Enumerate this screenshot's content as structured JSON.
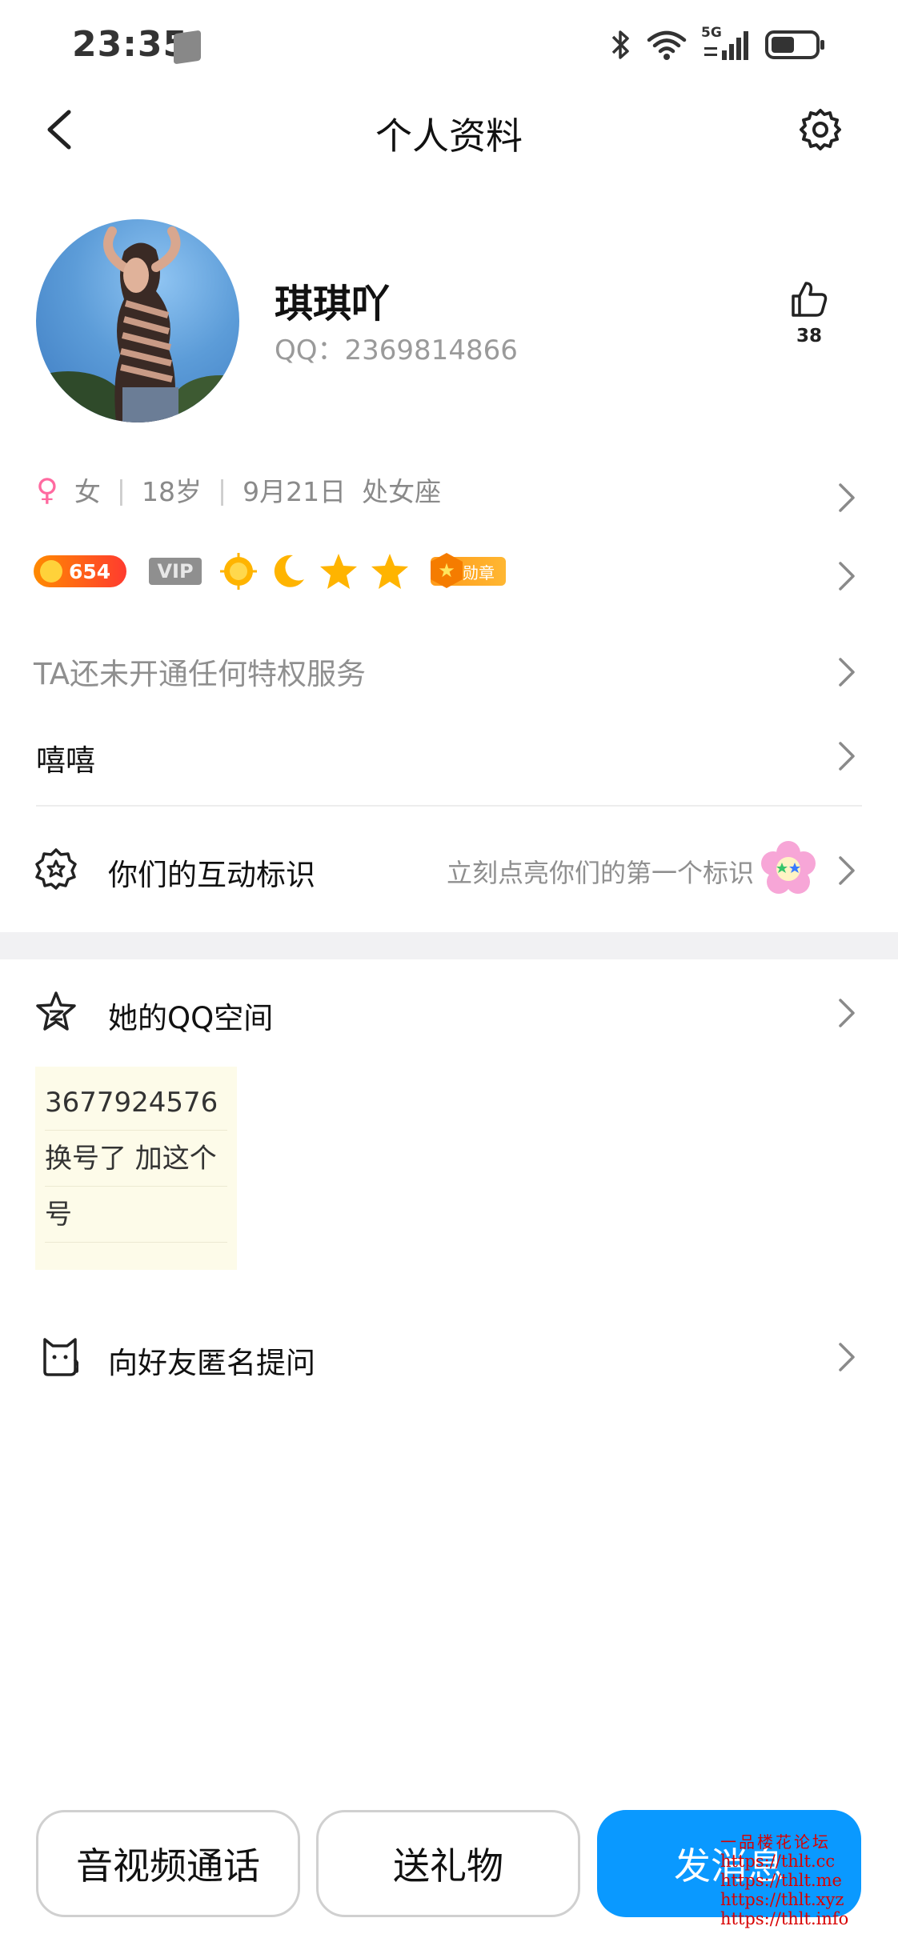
{
  "status_bar": {
    "time": "23:35",
    "network": "5G"
  },
  "header": {
    "title": "个人资料"
  },
  "profile": {
    "nickname": "琪琪吖",
    "qq_label": "QQ：2369814866",
    "likes": "38"
  },
  "info": {
    "gender": "女",
    "age": "18岁",
    "birthday": "9月21日",
    "zodiac": "处女座"
  },
  "badges": {
    "level": "654",
    "vip": "VIP",
    "medal": "勋章"
  },
  "privilege_text": "TA还未开通任何特权服务",
  "signature": "嘻嘻",
  "interaction": {
    "label": "你们的互动标识",
    "hint": "立刻点亮你们的第一个标识"
  },
  "qzone": {
    "label": "她的QQ空间",
    "note_lines": [
      "3677924576",
      "换号了 加这个",
      "号"
    ]
  },
  "ask": {
    "label": "向好友匿名提问"
  },
  "actions": {
    "call": "音视频通话",
    "gift": "送礼物",
    "message": "发消息"
  },
  "watermark": {
    "title": "一品楼花论坛",
    "urls": [
      "https://thlt.cc",
      "https://thlt.me",
      "https://thlt.xyz",
      "https://thlt.info"
    ]
  },
  "colors": {
    "accent": "#0a99ff",
    "gender": "#ff6aa0",
    "level": "#ff3b2f",
    "medal": "#ff9b1a"
  }
}
